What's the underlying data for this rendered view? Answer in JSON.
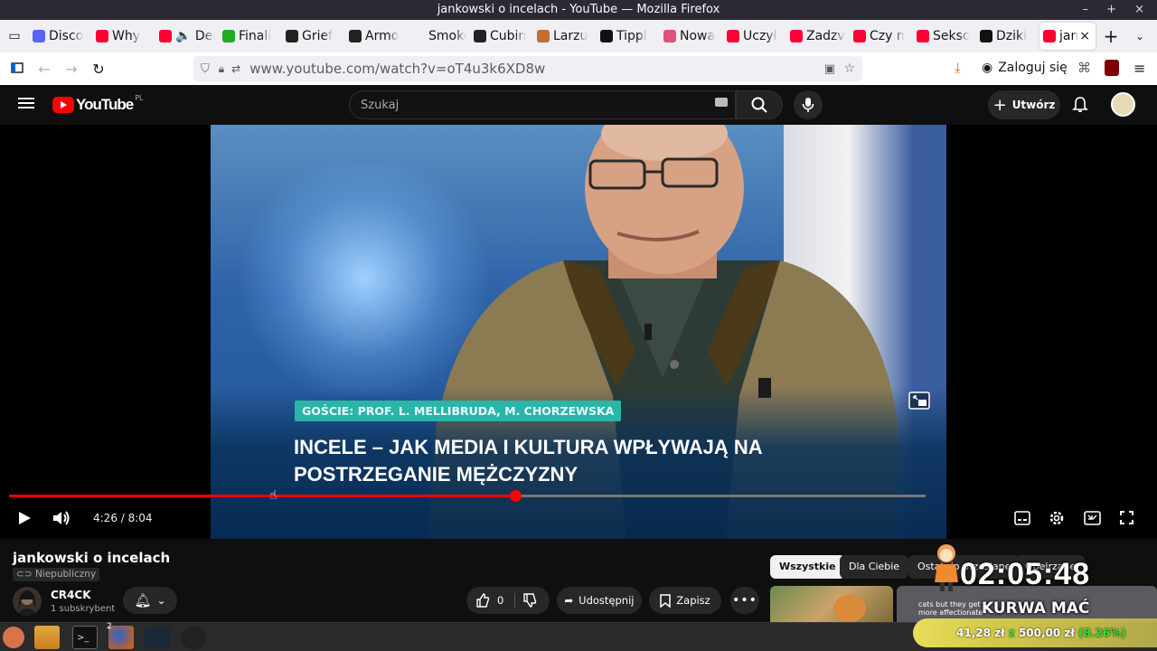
{
  "window": {
    "title": "jankowski o incelach - YouTube — Mozilla Firefox"
  },
  "tabs": [
    {
      "label": "Disco",
      "color": "#5865f2"
    },
    {
      "label": "Why",
      "color": "#ff0033"
    },
    {
      "label": "🔈 Dea",
      "color": "#ff0033"
    },
    {
      "label": "Finali",
      "color": "#22aa22"
    },
    {
      "label": "Grief",
      "color": "#222222"
    },
    {
      "label": "Armo",
      "color": "#222222"
    },
    {
      "label": "Smoke F",
      "color": "#f0f0f4"
    },
    {
      "label": "Cubin",
      "color": "#222222"
    },
    {
      "label": "Larzu",
      "color": "#c07030"
    },
    {
      "label": "Tippl",
      "color": "#111111"
    },
    {
      "label": "Nowa",
      "color": "#e0507a"
    },
    {
      "label": "Uczył",
      "color": "#ff0033"
    },
    {
      "label": "Zadzv",
      "color": "#ff0033"
    },
    {
      "label": "Czy n",
      "color": "#ff0033"
    },
    {
      "label": "Seksc",
      "color": "#ff0033"
    },
    {
      "label": "Dziki",
      "color": "#111111"
    },
    {
      "label": "jan",
      "color": "#ff0033"
    }
  ],
  "nav": {
    "url_host": "www.youtube.com",
    "url_path": "/watch?v=oT4u3k6XD8w",
    "login": "Zaloguj się"
  },
  "yt": {
    "logo": "YouTube",
    "region": "PL",
    "search_placeholder": "Szukaj",
    "create": "Utwórz"
  },
  "video": {
    "guests": "GOŚCIE: PROF. L. MELLIBRUDA, M. CHORZEWSKA",
    "headline": "INCELE – JAK MEDIA I KULTURA WPŁYWAJĄ NA POSTRZEGANIE MĘŻCZYZNY",
    "time": "4:26 / 8:04",
    "progress": 0.5526
  },
  "info": {
    "title": "jankowski o incelach",
    "visibility": "Niepubliczny",
    "channel": "CR4CK",
    "subscribers": "1 subskrybent",
    "likes": "0",
    "share": "Udostępnij",
    "save": "Zapisz"
  },
  "chips": [
    "Wszystkie",
    "Dla Ciebie",
    "Ostatnio przesłane",
    "Obejrzane"
  ],
  "thumbs": {
    "caption": "cats but they get more affectionate"
  },
  "overlay": {
    "clock": "02:05:48",
    "text": "KURWA MAĆ",
    "raised": "41,28 zł",
    "goal_prefix": "z",
    "goal": "500,00 zł",
    "percent": "(8.26%)"
  },
  "taskbar": {
    "firefox_badge": "2"
  }
}
